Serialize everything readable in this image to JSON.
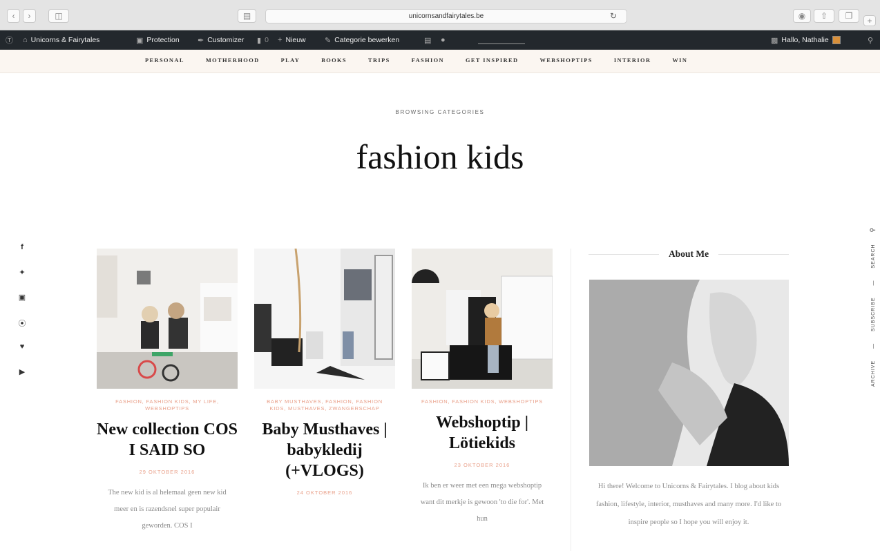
{
  "browser": {
    "url": "unicornsandfairytales.be"
  },
  "adminbar": {
    "site_name": "Unicorns & Fairytales",
    "protection": "Protection",
    "customizer": "Customizer",
    "comments_count": "0",
    "new_label": "Nieuw",
    "edit_category": "Categorie bewerken",
    "greeting": "Hallo, Nathalie"
  },
  "nav": {
    "items": [
      "PERSONAL",
      "MOTHERHOOD",
      "PLAY",
      "BOOKS",
      "TRIPS",
      "FASHION",
      "GET INSPIRED",
      "WEBSHOPTIPS",
      "INTERIOR",
      "WIN"
    ]
  },
  "page": {
    "browsing": "BROWSING CATEGORIES",
    "title": "fashion kids"
  },
  "social": {
    "icons": [
      "facebook-icon",
      "twitter-icon",
      "instagram-icon",
      "pinterest-icon",
      "bloglovin-heart-icon",
      "youtube-icon"
    ]
  },
  "posts": [
    {
      "categories": "FASHION, FASHION KIDS, MY LIFE, WEBSHOPTIPS",
      "title": "New collection COS I SAID SO",
      "date": "29 OKTOBER 2016",
      "excerpt": "The new kid is al helemaal geen new kid meer en is razendsnel super populair geworden. COS I"
    },
    {
      "categories": "BABY MUSTHAVES, FASHION, FASHION KIDS, MUSTHAVES, ZWANGERSCHAP",
      "title": "Baby Musthaves | babykledij (+VLOGS)",
      "date": "24 OKTOBER 2016",
      "excerpt": ""
    },
    {
      "categories": "FASHION, FASHION KIDS, WEBSHOPTIPS",
      "title": "Webshoptip | Lötiekids",
      "date": "23 OKTOBER 2016",
      "excerpt": "Ik ben er weer met een mega webshoptip want dit merkje is gewoon 'to die for'. Met hun"
    }
  ],
  "sidebar": {
    "widget_title": "About Me",
    "text": "Hi there! Welcome to Unicorns & Fairytales. I blog about kids fashion, lifestyle, interior, musthaves and many more. I'd like to inspire people so I hope you will enjoy it."
  },
  "vertical": {
    "items": [
      "ARCHIVE",
      "—",
      "SUBSCRIBE",
      "—",
      "SEARCH"
    ]
  }
}
